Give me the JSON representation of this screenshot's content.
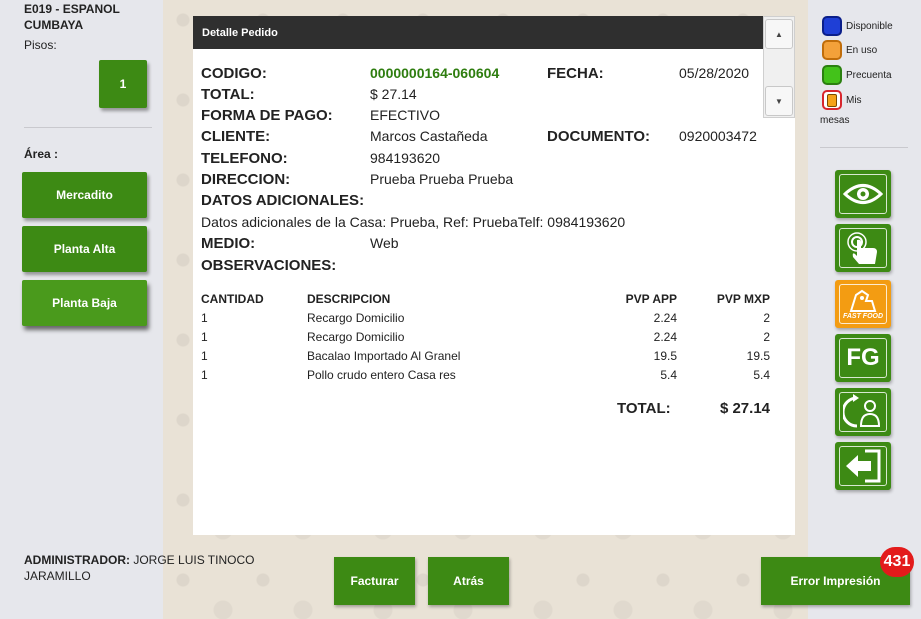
{
  "store": {
    "name": "E019 - ESPANOL CUMBAYA",
    "floors_label": "Pisos:",
    "floor_button": "1"
  },
  "areas": {
    "label": "Área :",
    "items": [
      "Mercadito",
      "Planta Alta",
      "Planta Baja"
    ]
  },
  "legend": {
    "items": [
      {
        "label": "Disponible",
        "color": "#1f3fd6",
        "border": "#0b1f8a"
      },
      {
        "label": "En uso",
        "color": "#f3a13a",
        "border": "#c06d0a"
      },
      {
        "label": "Precuenta",
        "color": "#43c21a",
        "border": "#2b8010"
      },
      {
        "label": "Mis",
        "color": "#f5a31a",
        "border": "#d8262e"
      }
    ],
    "mesas_label": "mesas"
  },
  "right_icons": [
    "eye-icon",
    "touch-icon",
    "fast-food-icon",
    "fg-icon",
    "user-rotate-icon",
    "exit-icon"
  ],
  "fast_food_label": "FAST FOOD",
  "fg_label": "FG",
  "dialog": {
    "title": "Detalle Pedido",
    "codigo_label": "CODIGO:",
    "codigo": "0000000164-060604",
    "fecha_label": "FECHA:",
    "fecha": "05/28/2020",
    "total_label": "TOTAL:",
    "total": "$ 27.14",
    "forma_label": "FORMA DE PAGO:",
    "forma": "EFECTIVO",
    "cliente_label": "CLIENTE:",
    "cliente": "Marcos Castañeda",
    "documento_label": "DOCUMENTO:",
    "documento": "0920003472",
    "telefono_label": "TELEFONO:",
    "telefono": "984193620",
    "direccion_label": "DIRECCION:",
    "direccion": "Prueba Prueba Prueba",
    "adicionales_label": "DATOS ADICIONALES:",
    "adicionales": "Datos adicionales de la Casa: Prueba, Ref: PruebaTelf: 0984193620",
    "medio_label": "MEDIO:",
    "medio": "Web",
    "observaciones_label": "OBSERVACIONES:",
    "table": {
      "headers": [
        "CANTIDAD",
        "DESCRIPCION",
        "PVP APP",
        "PVP MXP"
      ],
      "rows": [
        [
          "1",
          "Recargo Domicilio",
          "2.24",
          "2"
        ],
        [
          "1",
          "Recargo Domicilio",
          "2.24",
          "2"
        ],
        [
          "1",
          "Bacalao Importado Al Granel",
          "19.5",
          "19.5"
        ],
        [
          "1",
          "Pollo crudo entero Casa res",
          "5.4",
          "5.4"
        ]
      ]
    },
    "grand_total_label": "TOTAL:",
    "grand_total": "$ 27.14"
  },
  "footer": {
    "admin_label": "ADMINISTRADOR:",
    "admin_name": "JORGE LUIS TINOCO JARAMILLO",
    "facturar": "Facturar",
    "atras": "Atrás",
    "error": "Error Impresión",
    "error_count": "431"
  }
}
